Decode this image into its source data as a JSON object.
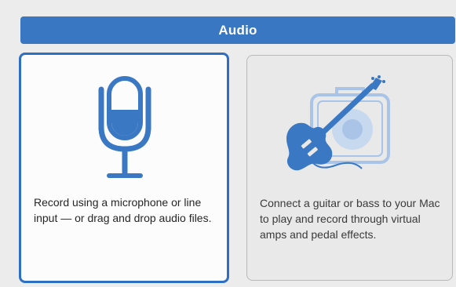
{
  "header": {
    "title": "Audio"
  },
  "cards": [
    {
      "icon": "microphone-icon",
      "description": "Record using a microphone or line input — or drag and drop audio files.",
      "selected": true
    },
    {
      "icon": "guitar-amp-icon",
      "description": "Connect a guitar or bass to your Mac to play and record through virtual amps and pedal effects.",
      "selected": false
    }
  ],
  "colors": {
    "accent": "#3a77c3",
    "icon_fill": "#3b78c4",
    "icon_light": "#a9c4e6",
    "selected_border": "#2e6fc3"
  }
}
